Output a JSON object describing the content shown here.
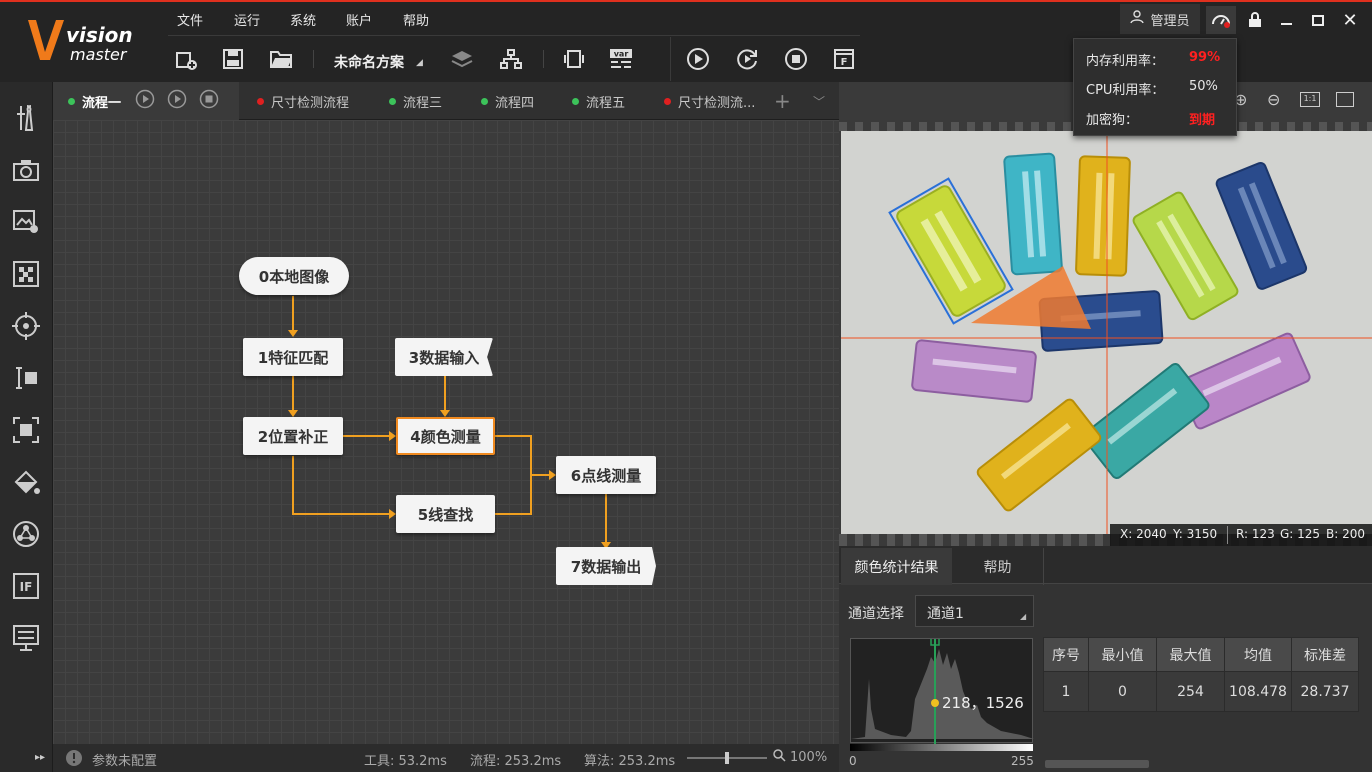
{
  "app": {
    "logo_main": "vision",
    "logo_sub": "master",
    "scheme_name": "未命名方案"
  },
  "menu": [
    "文件",
    "运行",
    "系统",
    "账户",
    "帮助"
  ],
  "user": {
    "label": "管理员"
  },
  "popup": {
    "memory_label": "内存利用率：",
    "memory_value": "99%",
    "cpu_label": "CPU利用率：",
    "cpu_value": "50%",
    "dongle_label": "加密狗：",
    "dongle_value": "到期"
  },
  "tabs": [
    {
      "label": "流程一",
      "dot": "#3cc35a"
    },
    {
      "label": "尺寸检测流程",
      "dot": "#e02020"
    },
    {
      "label": "流程三",
      "dot": "#3cc35a"
    },
    {
      "label": "流程四",
      "dot": "#3cc35a"
    },
    {
      "label": "流程五",
      "dot": "#3cc35a"
    },
    {
      "label": "尺寸检测流...",
      "dot": "#e02020"
    }
  ],
  "nodes": {
    "n0": "0本地图像",
    "n1": "1特征匹配",
    "n2": "2位置补正",
    "n3": "3数据输入",
    "n4": "4颜色测量",
    "n5": "5线查找",
    "n6": "6点线测量",
    "n7": "7数据输出"
  },
  "status": {
    "param_text": "参数未配置",
    "tool_time": "工具: 53.2ms",
    "flow_time": "流程: 253.2ms",
    "algo_time": "算法: 253.2ms",
    "zoom": "100%"
  },
  "coords": {
    "x": "X: 2040",
    "y": "Y: 3150",
    "r": "R: 123",
    "g": "G: 125",
    "b": "B: 200"
  },
  "result": {
    "tab_active": "颜色统计结果",
    "tab_help": "帮助",
    "channel_label": "通道选择",
    "channel_value": "通道1",
    "hist_readout": "218，1526",
    "hist_min": "0",
    "hist_max": "255",
    "table_headers": [
      "序号",
      "最小值",
      "最大值",
      "均值",
      "标准差"
    ],
    "table_row": [
      "1",
      "0",
      "254",
      "108.478",
      "28.737"
    ]
  },
  "colors": {
    "accent": "#e0301e",
    "connector": "#f0a020",
    "highlight": "#f08a20"
  }
}
